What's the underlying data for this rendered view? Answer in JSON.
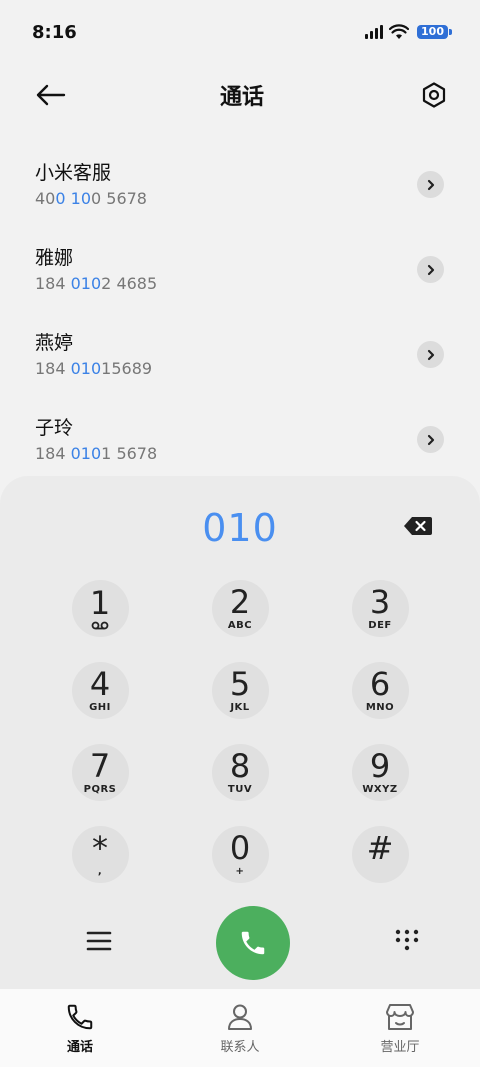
{
  "status": {
    "time": "8:16",
    "battery": "100"
  },
  "header": {
    "title": "通话"
  },
  "results": [
    {
      "name": "小米客服",
      "num_pre": "40",
      "num_hl1": "0",
      "num_mid": " ",
      "num_hl2": "10",
      "num_post": "0 5678"
    },
    {
      "name": "雅娜",
      "num_pre": "184 ",
      "num_hl1": "010",
      "num_mid": "",
      "num_hl2": "",
      "num_post": "2 4685"
    },
    {
      "name": "燕婷",
      "num_pre": "184 ",
      "num_hl1": "010",
      "num_mid": "",
      "num_hl2": "",
      "num_post": "15689"
    },
    {
      "name": "子玲",
      "num_pre": "184 ",
      "num_hl1": "010",
      "num_mid": "",
      "num_hl2": "",
      "num_post": "1 5678"
    }
  ],
  "dialpad": {
    "input": "010",
    "keys": [
      {
        "digit": "1",
        "sub": ""
      },
      {
        "digit": "2",
        "sub": "ABC"
      },
      {
        "digit": "3",
        "sub": "DEF"
      },
      {
        "digit": "4",
        "sub": "GHI"
      },
      {
        "digit": "5",
        "sub": "JKL"
      },
      {
        "digit": "6",
        "sub": "MNO"
      },
      {
        "digit": "7",
        "sub": "PQRS"
      },
      {
        "digit": "8",
        "sub": "TUV"
      },
      {
        "digit": "9",
        "sub": "WXYZ"
      },
      {
        "digit": "*",
        "sub": ","
      },
      {
        "digit": "0",
        "sub": "+"
      },
      {
        "digit": "#",
        "sub": ""
      }
    ]
  },
  "tabs": [
    {
      "label": "通话",
      "icon": "phone-icon",
      "active": true
    },
    {
      "label": "联系人",
      "icon": "person-icon",
      "active": false
    },
    {
      "label": "营业厅",
      "icon": "store-icon",
      "active": false
    }
  ],
  "colors": {
    "accent": "#3b82e6",
    "call": "#4caf5e",
    "battery": "#2f6fd6"
  }
}
